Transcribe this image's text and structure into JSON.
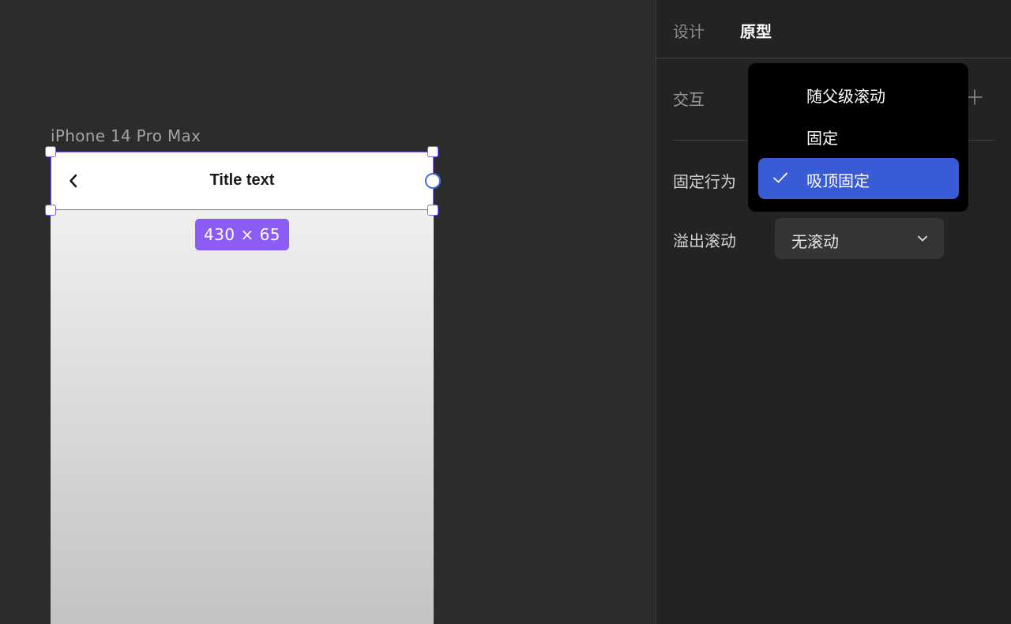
{
  "canvas": {
    "frame_label": "iPhone 14 Pro Max",
    "navbar": {
      "back_icon": "chevron-left-icon",
      "title": "Title text"
    },
    "size_badge": "430 × 65",
    "colors": {
      "selection": "#7b61ff",
      "badge": "#8b5cf6",
      "handle_circle": "#4a6fe0"
    }
  },
  "panel": {
    "tabs": [
      {
        "label": "设计",
        "active": false
      },
      {
        "label": "原型",
        "active": true
      }
    ],
    "interaction": {
      "label": "交互",
      "add_icon": "plus-icon"
    },
    "fixed_behavior": {
      "label": "固定行为"
    },
    "overflow_scroll": {
      "label": "溢出滚动",
      "value": "无滚动",
      "chevron_icon": "chevron-down-icon"
    }
  },
  "dropdown": {
    "options": [
      {
        "label": "随父级滚动",
        "selected": false
      },
      {
        "label": "固定",
        "selected": false
      },
      {
        "label": "吸顶固定",
        "selected": true
      }
    ],
    "selected_icon": "check-icon",
    "colors": {
      "background": "#000000",
      "selected": "#3a5bd6"
    }
  }
}
